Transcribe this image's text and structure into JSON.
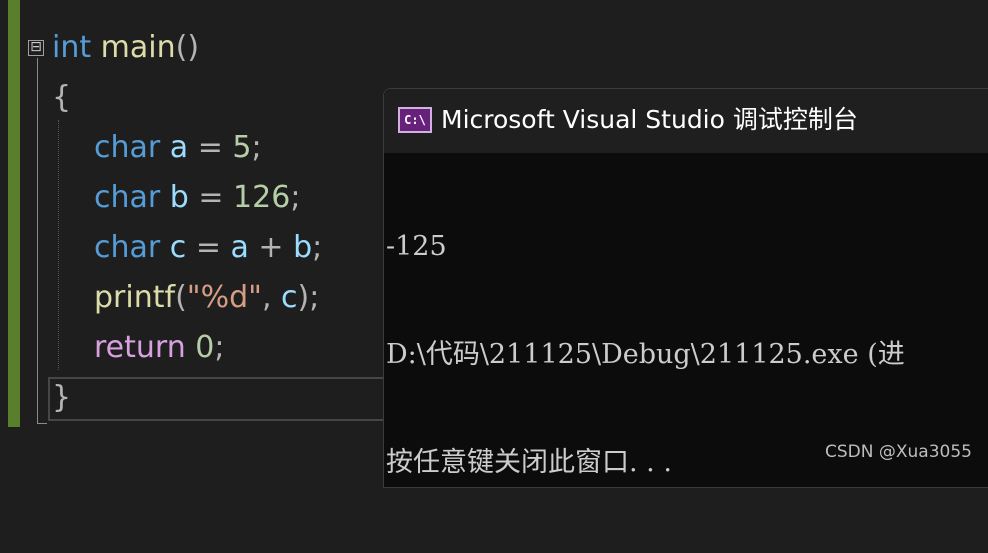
{
  "editor": {
    "fold_symbol": "⊟",
    "lines": [
      {
        "kw": "int",
        "fn": "main",
        "rest": "()"
      },
      {
        "text": "{"
      },
      {
        "kw": "char",
        "var": "a",
        "op": " = ",
        "num": "5",
        "end": ";"
      },
      {
        "kw": "char",
        "var": "b",
        "op": " = ",
        "num": "126",
        "end": ";"
      },
      {
        "kw": "char",
        "var": "c",
        "op": " = ",
        "var2": "a",
        "op2": " + ",
        "var3": "b",
        "end": ";"
      },
      {
        "fn": "printf",
        "open": "(",
        "str": "\"%d\"",
        "comma": ", ",
        "var": "c",
        "close": ");"
      },
      {
        "ctrl": "return",
        "num": "0",
        "end": ";"
      },
      {
        "text": "}"
      }
    ]
  },
  "console": {
    "title": "Microsoft Visual Studio 调试控制台",
    "icon_text": "C:\\",
    "icon_name": "console-app-icon",
    "output": [
      "-125",
      "D:\\代码\\211125\\Debug\\211125.exe (进",
      "按任意键关闭此窗口. . ."
    ]
  },
  "watermark": "CSDN @Xua3055",
  "colors": {
    "editor_bg": "#1e1e1e",
    "keyword": "#569cd6",
    "control_keyword": "#d8a0df",
    "number": "#b5cea8",
    "string": "#d69d85",
    "function": "#dcdcaa",
    "variable": "#9cdcfe",
    "console_bg": "#0c0c0c",
    "change_bar": "#5a7f2c"
  }
}
